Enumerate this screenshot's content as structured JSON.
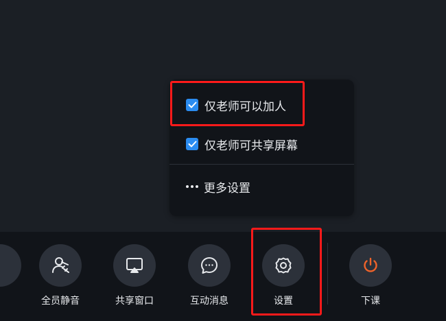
{
  "popup": {
    "items": [
      {
        "label": "仅老师可以加人",
        "checked": true
      },
      {
        "label": "仅老师可共享屏幕",
        "checked": true
      },
      {
        "label": "更多设置"
      }
    ]
  },
  "toolbar": {
    "items": [
      {
        "label": "全员静音",
        "icon": "mute-all-icon"
      },
      {
        "label": "共享窗口",
        "icon": "share-window-icon"
      },
      {
        "label": "互动消息",
        "icon": "chat-icon"
      },
      {
        "label": "设置",
        "icon": "gear-icon"
      },
      {
        "label": "下课",
        "icon": "power-icon"
      }
    ]
  },
  "colors": {
    "background": "#1b1f25",
    "panel": "#111419",
    "button": "#2c313a",
    "checkbox": "#2b8cf0",
    "highlight": "#ff1a1a",
    "end_class": "#f0632a"
  }
}
